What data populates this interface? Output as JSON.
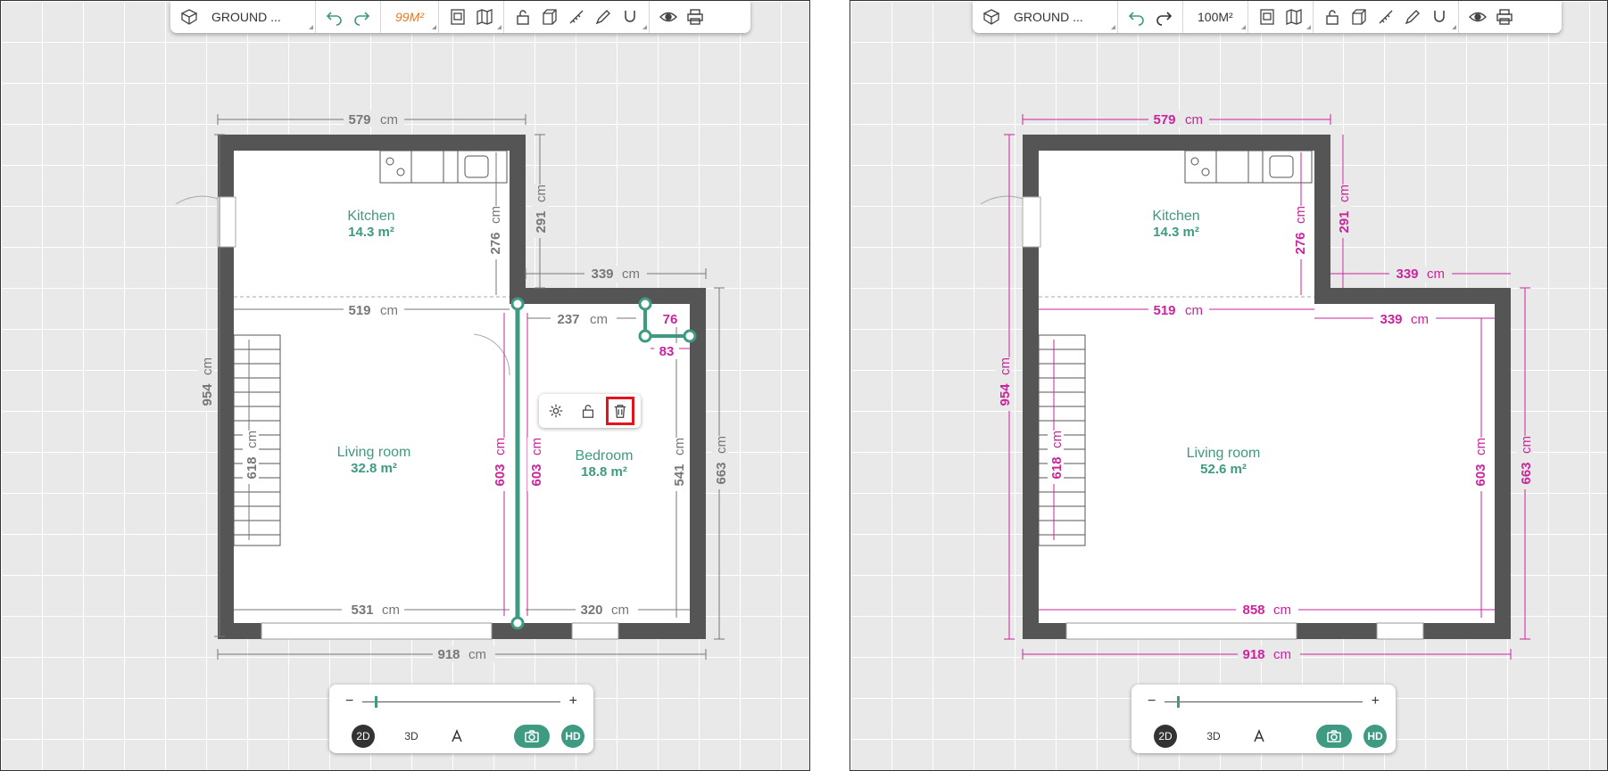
{
  "colors": {
    "wall": "#555555",
    "accent": "#3e9a80",
    "dimension": "#c9259c",
    "dimension_gray": "#777777",
    "highlight": "#e0161c",
    "area_orange": "#e87722"
  },
  "left": {
    "toolbar": {
      "level": "GROUND ...",
      "area": "99M²"
    },
    "rooms": [
      {
        "name": "Kitchen",
        "area": "14.3 m²"
      },
      {
        "name": "Living room",
        "area": "32.8 m²"
      },
      {
        "name": "Bedroom",
        "area": "18.8 m²"
      }
    ],
    "dims": {
      "top": "579",
      "unit": "cm",
      "kitchen_h": "276",
      "ext_291": "291",
      "ext_339": "339",
      "mid_519": "519",
      "bed_237": "237",
      "small_76": "76",
      "small_83": "83",
      "left_954": "954",
      "stair_618": "618",
      "wall_603a": "603",
      "wall_603b": "603",
      "bed_541": "541",
      "right_663": "663",
      "bottom_531": "531",
      "bottom_320": "320",
      "total_918": "918"
    },
    "popup": {
      "icons": [
        "gear-icon",
        "unlock-icon",
        "trash-icon"
      ]
    }
  },
  "right": {
    "toolbar": {
      "level": "GROUND ...",
      "area": "100M²"
    },
    "rooms": [
      {
        "name": "Kitchen",
        "area": "14.3 m²"
      },
      {
        "name": "Living room",
        "area": "52.6 m²"
      }
    ],
    "dims": {
      "top": "579",
      "unit": "cm",
      "kitchen_h": "276",
      "ext_291": "291",
      "ext_339a": "339",
      "mid_519": "519",
      "ext_339b": "339",
      "left_954": "954",
      "stair_618": "618",
      "inner_603": "603",
      "right_663": "663",
      "bottom_858": "858",
      "total_918": "918"
    }
  },
  "bottom": {
    "zoom_minus": "−",
    "zoom_plus": "+",
    "zoom_level": 0.06,
    "modes": {
      "2d": "2D",
      "3d": "3D",
      "hd": "HD"
    }
  }
}
